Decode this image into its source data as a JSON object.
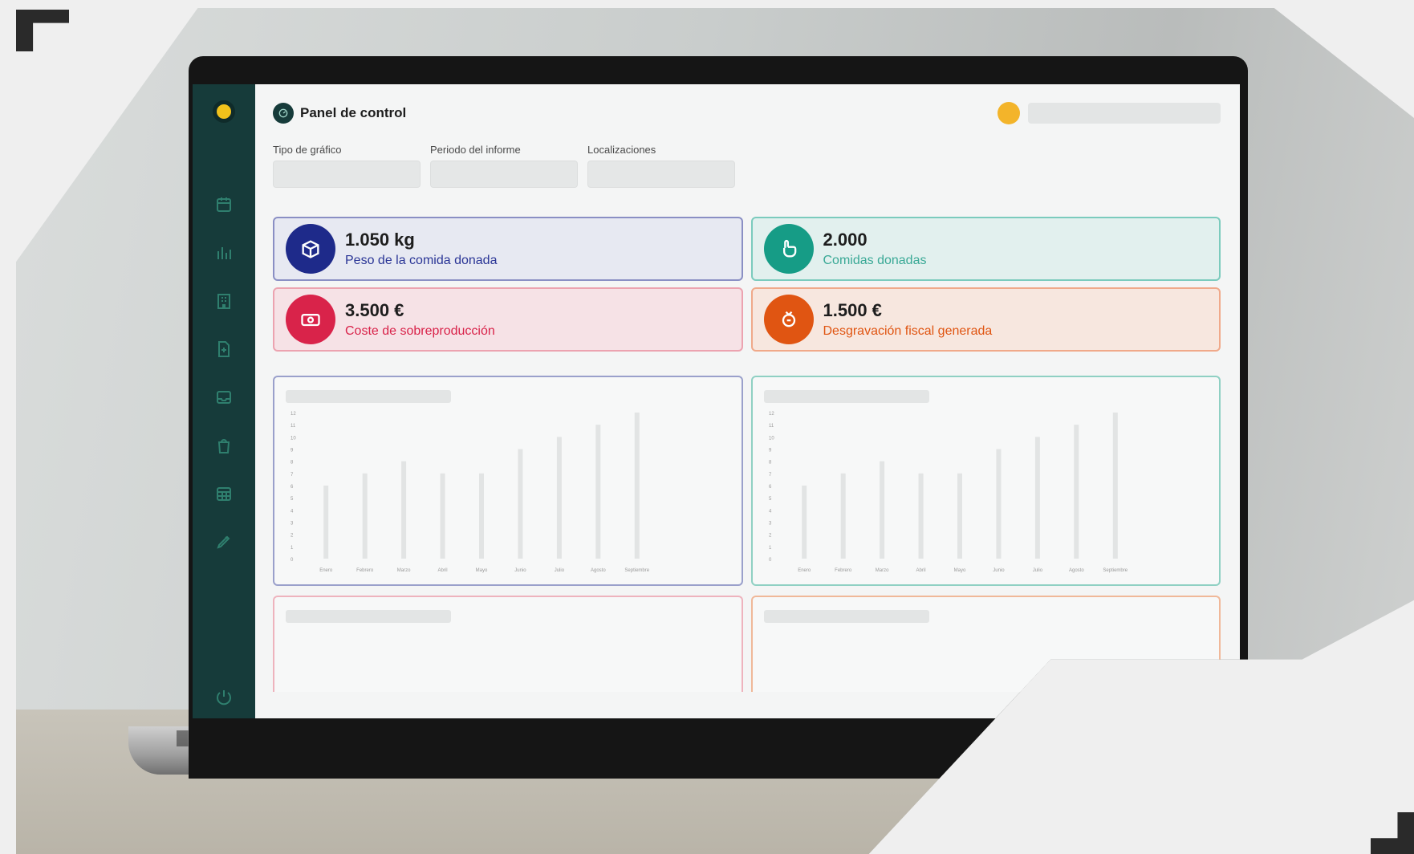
{
  "app": {
    "title": "Panel de control"
  },
  "filters": [
    {
      "label": "Tipo de gráfico",
      "value": ""
    },
    {
      "label": "Periodo del informe",
      "value": ""
    },
    {
      "label": "Localizaciones",
      "value": ""
    }
  ],
  "kpis": [
    {
      "value": "1.050 kg",
      "label": "Peso de la comida donada",
      "accent": "#1e2a8a",
      "icon": "box-icon"
    },
    {
      "value": "2.000",
      "label": "Comidas donadas",
      "accent": "#169c86",
      "icon": "hand-icon"
    },
    {
      "value": "3.500 €",
      "label": "Coste de sobreproducción",
      "accent": "#d9234a",
      "icon": "money-icon"
    },
    {
      "value": "1.500 €",
      "label": "Desgravación fiscal generada",
      "accent": "#e05512",
      "icon": "tax-icon"
    }
  ],
  "sidebar": {
    "icons": [
      "calendar-icon",
      "chart-icon",
      "building-icon",
      "document-add-icon",
      "inbox-icon",
      "bag-icon",
      "calendar-grid-icon",
      "edit-icon"
    ],
    "bottom_icon": "power-icon"
  },
  "chart_data": [
    {
      "type": "bar",
      "categories": [
        "Enero",
        "Febrero",
        "Marzo",
        "Abril",
        "Mayo",
        "Junio",
        "Julio",
        "Agosto",
        "Septiembre"
      ],
      "values": [
        6,
        7,
        8,
        7,
        7,
        9,
        10,
        11,
        12
      ],
      "ylim": [
        0,
        12
      ]
    },
    {
      "type": "bar",
      "categories": [
        "Enero",
        "Febrero",
        "Marzo",
        "Abril",
        "Mayo",
        "Junio",
        "Julio",
        "Agosto",
        "Septiembre"
      ],
      "values": [
        6,
        7,
        8,
        7,
        7,
        9,
        10,
        11,
        12
      ],
      "ylim": [
        0,
        12
      ]
    }
  ],
  "colors": {
    "sidebar": "#163b3a",
    "accent_yellow": "#f3b42a",
    "card_navy_border": "#8a8fc4",
    "card_teal_border": "#7bcbbd",
    "card_red_border": "#eca3b0",
    "card_orange_border": "#f0a98a"
  }
}
